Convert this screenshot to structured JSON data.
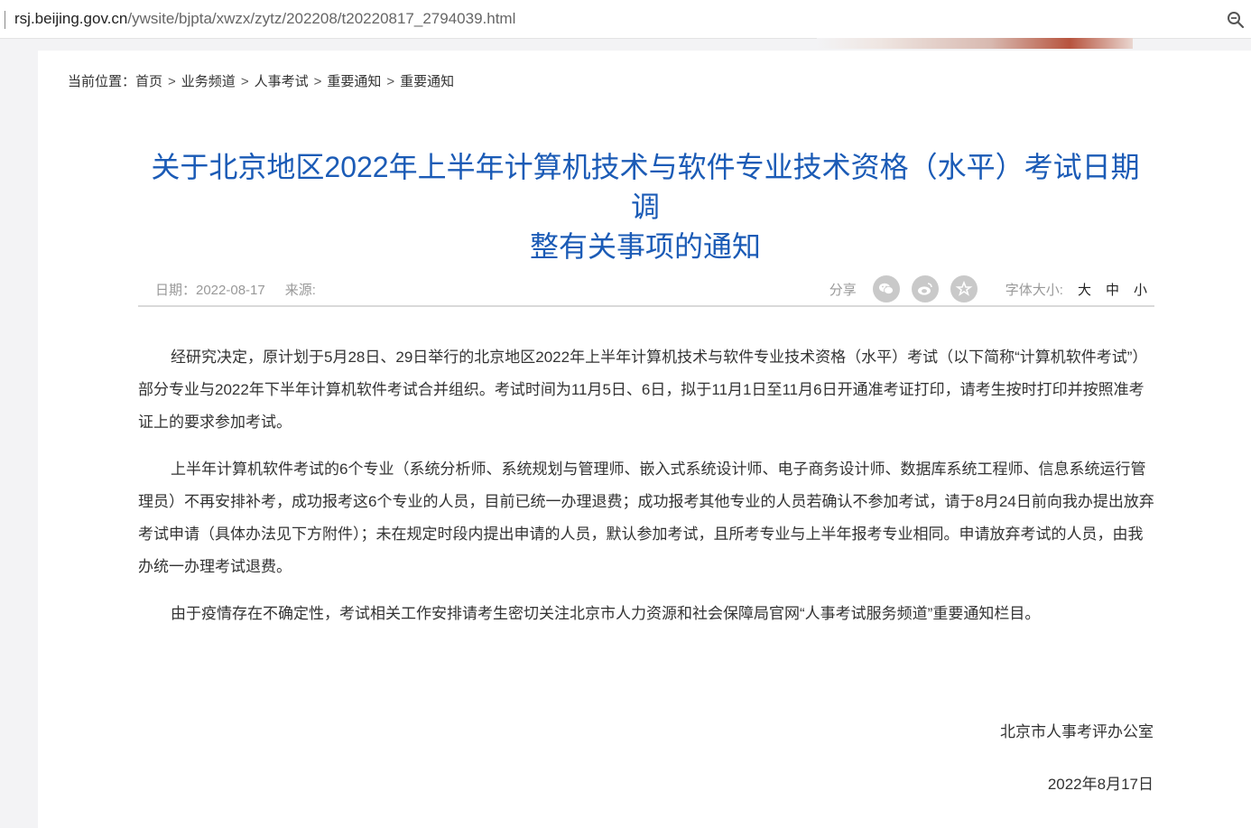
{
  "browser": {
    "url_host": "rsj.beijing.gov.cn",
    "url_path": "/ywsite/bjpta/xwzx/zytz/202208/t20220817_2794039.html",
    "zoom_icon": "zoom-icon"
  },
  "breadcrumb": {
    "prefix": "当前位置：",
    "items": [
      "首页",
      "业务频道",
      "人事考试",
      "重要通知",
      "重要通知"
    ],
    "separator": ">"
  },
  "article": {
    "title_line1": "关于北京地区2022年上半年计算机技术与软件专业技术资格（水平）考试日期调",
    "title_line2": "整有关事项的通知",
    "date_text": "日期：2022-08-17",
    "source_text": "来源:",
    "share_label": "分享",
    "share_icons": [
      "wechat-icon",
      "weibo-icon",
      "favorite-icon"
    ],
    "font_size_label": "字体大小:",
    "font_size_options": [
      "大",
      "中",
      "小"
    ],
    "paragraphs": [
      "经研究决定，原计划于5月28日、29日举行的北京地区2022年上半年计算机技术与软件专业技术资格（水平）考试（以下简称“计算机软件考试”）部分专业与2022年下半年计算机软件考试合并组织。考试时间为11月5日、6日，拟于11月1日至11月6日开通准考证打印，请考生按时打印并按照准考证上的要求参加考试。",
      "上半年计算机软件考试的6个专业（系统分析师、系统规划与管理师、嵌入式系统设计师、电子商务设计师、数据库系统工程师、信息系统运行管理员）不再安排补考，成功报考这6个专业的人员，目前已统一办理退费；成功报考其他专业的人员若确认不参加考试，请于8月24日前向我办提出放弃考试申请（具体办法见下方附件）；未在规定时段内提出申请的人员，默认参加考试，且所考专业与上半年报考专业相同。申请放弃考试的人员，由我办统一办理考试退费。",
      "由于疫情存在不确定性，考试相关工作安排请考生密切关注北京市人力资源和社会保障局官网“人事考试服务频道”重要通知栏目。"
    ],
    "signature": "北京市人事考评办公室",
    "sign_date": "2022年8月17日"
  },
  "colors": {
    "title": "#1b5bb6",
    "body_text": "#333333",
    "meta_text": "#999999",
    "share_icon_bg": "#c9c9c9"
  }
}
